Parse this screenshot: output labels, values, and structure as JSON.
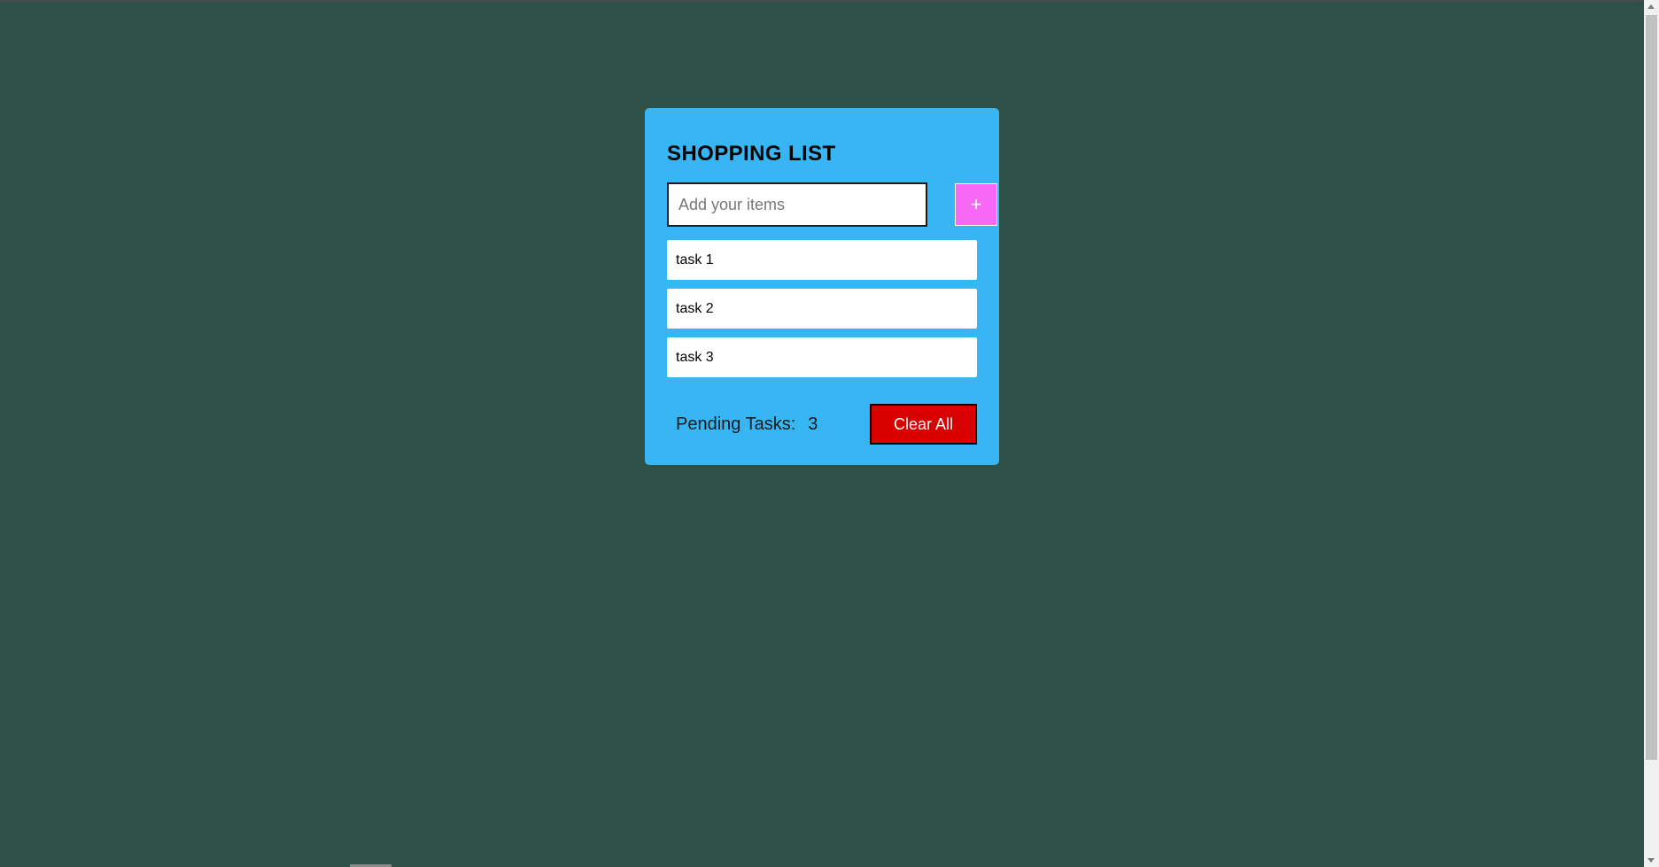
{
  "app": {
    "title": "SHOPPING LIST"
  },
  "input": {
    "value": "",
    "placeholder": "Add your items"
  },
  "add_button": {
    "label": "+"
  },
  "tasks": [
    {
      "label": "task 1"
    },
    {
      "label": "task 2"
    },
    {
      "label": "task 3"
    }
  ],
  "footer": {
    "pending_label": "Pending Tasks:",
    "pending_count": "3",
    "clear_label": "Clear All"
  },
  "colors": {
    "page_background": "#2e5147",
    "card_background": "#38b6f4",
    "add_button": "#f768f4",
    "clear_button": "#d90000"
  },
  "icons": {
    "add": "plus-icon"
  }
}
